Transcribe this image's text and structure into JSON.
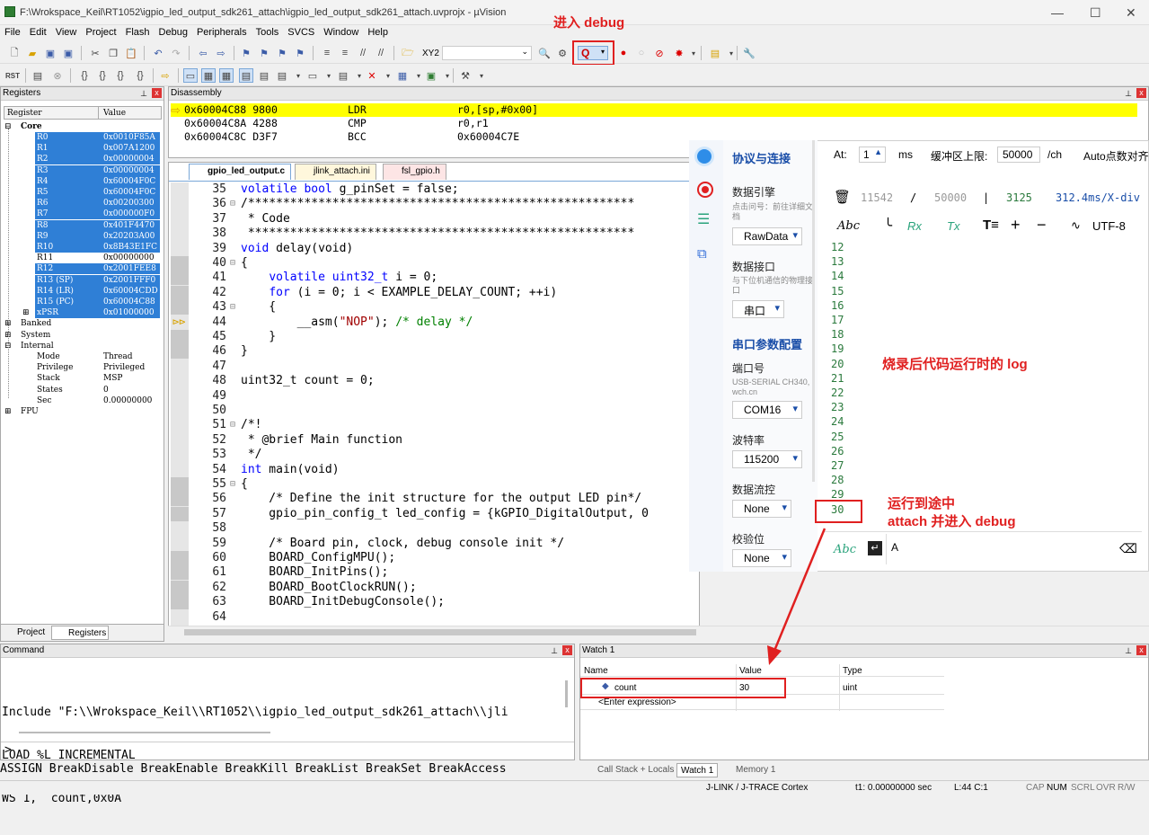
{
  "window": {
    "title": "F:\\Wrokspace_Keil\\RT1052\\igpio_led_output_sdk261_attach\\igpio_led_output_sdk261_attach.uvprojx - µVision"
  },
  "menu": [
    "File",
    "Edit",
    "View",
    "Project",
    "Flash",
    "Debug",
    "Peripherals",
    "Tools",
    "SVCS",
    "Window",
    "Help"
  ],
  "toolbar": {
    "target_label": "XY2"
  },
  "annotations": {
    "enter_debug": "进入 debug",
    "log_label": "烧录后代码运行时的 log",
    "attach_line1": "运行到途中",
    "attach_line2": "attach 并进入 debug"
  },
  "registers": {
    "title": "Registers",
    "col_register": "Register",
    "col_value": "Value",
    "core_label": "Core",
    "rows": [
      {
        "name": "R0",
        "value": "0x0010F85A"
      },
      {
        "name": "R1",
        "value": "0x007A1200"
      },
      {
        "name": "R2",
        "value": "0x00000004"
      },
      {
        "name": "R3",
        "value": "0x00000004"
      },
      {
        "name": "R4",
        "value": "0x60004F0C"
      },
      {
        "name": "R5",
        "value": "0x60004F0C"
      },
      {
        "name": "R6",
        "value": "0x00200300"
      },
      {
        "name": "R7",
        "value": "0x000000F0"
      },
      {
        "name": "R8",
        "value": "0x401F4470"
      },
      {
        "name": "R9",
        "value": "0x20203A00"
      },
      {
        "name": "R10",
        "value": "0x8B43E1FC"
      },
      {
        "name": "R11",
        "value": "0x00000000"
      },
      {
        "name": "R12",
        "value": "0x2001FEE8"
      },
      {
        "name": "R13 (SP)",
        "value": "0x2001FFF0"
      },
      {
        "name": "R14 (LR)",
        "value": "0x60004CDD"
      },
      {
        "name": "R15 (PC)",
        "value": "0x60004C88"
      },
      {
        "name": "xPSR",
        "value": "0x01000000"
      }
    ],
    "groups": [
      "Banked",
      "System",
      "Internal"
    ],
    "internal": [
      {
        "name": "Mode",
        "value": "Thread"
      },
      {
        "name": "Privilege",
        "value": "Privileged"
      },
      {
        "name": "Stack",
        "value": "MSP"
      },
      {
        "name": "States",
        "value": "0"
      },
      {
        "name": "Sec",
        "value": "0.00000000"
      }
    ],
    "fpu": "FPU",
    "tab_project": "Project",
    "tab_registers": "Registers"
  },
  "disassembly": {
    "title": "Disassembly",
    "lines": [
      {
        "addr": "0x60004C88",
        "code": "9800",
        "mn": "LDR",
        "op": "r0,[sp,#0x00]"
      },
      {
        "addr": "0x60004C8A",
        "code": "4288",
        "mn": "CMP",
        "op": "r0,r1"
      },
      {
        "addr": "0x60004C8C",
        "code": "D3F7",
        "mn": "BCC",
        "op": "0x60004C7E"
      }
    ]
  },
  "editor": {
    "tabs": [
      "gpio_led_output.c",
      "jlink_attach.ini",
      "fsl_gpio.h"
    ],
    "lines": [
      {
        "n": "35",
        "f": "",
        "t": "volatile bool g_pinSet = false;",
        "k": "kw"
      },
      {
        "n": "36",
        "f": "⊟",
        "t": "/*******************************************************",
        "k": "cm"
      },
      {
        "n": "37",
        "f": "",
        "t": " * Code",
        "k": "cm"
      },
      {
        "n": "38",
        "f": "",
        "t": " *******************************************************",
        "k": "cm"
      },
      {
        "n": "39",
        "f": "",
        "t": "void delay(void)",
        "k": "kw"
      },
      {
        "n": "40",
        "f": "⊟",
        "t": "{",
        "k": ""
      },
      {
        "n": "41",
        "f": "",
        "t": "    volatile uint32_t i = 0;",
        "k": "kw"
      },
      {
        "n": "42",
        "f": "",
        "t": "    for (i = 0; i < EXAMPLE_DELAY_COUNT; ++i)",
        "k": "kw"
      },
      {
        "n": "43",
        "f": "⊟",
        "t": "    {",
        "k": ""
      },
      {
        "n": "44",
        "f": "",
        "t": "        __asm(\"NOP\"); /* delay */",
        "k": "st"
      },
      {
        "n": "45",
        "f": "",
        "t": "    }",
        "k": ""
      },
      {
        "n": "46",
        "f": "",
        "t": "}",
        "k": ""
      },
      {
        "n": "47",
        "f": "",
        "t": "",
        "k": ""
      },
      {
        "n": "48",
        "f": "",
        "t": "uint32_t count = 0;",
        "k": ""
      },
      {
        "n": "49",
        "f": "",
        "t": "",
        "k": ""
      },
      {
        "n": "50",
        "f": "",
        "t": "",
        "k": ""
      },
      {
        "n": "51",
        "f": "⊟",
        "t": "/*!",
        "k": "cm"
      },
      {
        "n": "52",
        "f": "",
        "t": " * @brief Main function",
        "k": "cm"
      },
      {
        "n": "53",
        "f": "",
        "t": " */",
        "k": "cm"
      },
      {
        "n": "54",
        "f": "",
        "t": "int main(void)",
        "k": "kw"
      },
      {
        "n": "55",
        "f": "⊟",
        "t": "{",
        "k": ""
      },
      {
        "n": "56",
        "f": "",
        "t": "    /* Define the init structure for the output LED pin*/",
        "k": "cm"
      },
      {
        "n": "57",
        "f": "",
        "t": "    gpio_pin_config_t led_config = {kGPIO_DigitalOutput, 0",
        "k": ""
      },
      {
        "n": "58",
        "f": "",
        "t": "",
        "k": ""
      },
      {
        "n": "59",
        "f": "",
        "t": "    /* Board pin, clock, debug console init */",
        "k": "cm"
      },
      {
        "n": "60",
        "f": "",
        "t": "    BOARD_ConfigMPU();",
        "k": ""
      },
      {
        "n": "61",
        "f": "",
        "t": "    BOARD_InitPins();",
        "k": ""
      },
      {
        "n": "62",
        "f": "",
        "t": "    BOARD_BootClockRUN();",
        "k": ""
      },
      {
        "n": "63",
        "f": "",
        "t": "    BOARD_InitDebugConsole();",
        "k": ""
      },
      {
        "n": "64",
        "f": "",
        "t": "",
        "k": ""
      }
    ]
  },
  "serial": {
    "cfg": {
      "h1": "协议与连接",
      "engine_label": "数据引擎",
      "engine_hint": "点击问号：前往详细文档",
      "engine_value": "RawData",
      "iface_label": "数据接口",
      "iface_hint": "与下位机通信的物理接口",
      "iface_value": "串口",
      "h2": "串口参数配置",
      "port_label": "端口号",
      "port_hint": "USB-SERIAL CH340, wch.cn",
      "port_value": "COM16",
      "baud_label": "波特率",
      "baud_value": "115200",
      "flow_label": "数据流控",
      "flow_value": "None",
      "parity_label": "校验位",
      "parity_value": "None"
    },
    "top": {
      "at_label": "At:",
      "at_value": "1",
      "ms": "ms",
      "buf_label": "缓冲区上限:",
      "buf_value": "50000",
      "ch": "/ch",
      "auto": "Auto点数对齐"
    },
    "stats": {
      "a": "11542",
      "sep": "/",
      "b": "50000",
      "bar": "|",
      "c": "3125",
      "d": "312.4ms/X-div"
    },
    "tools": {
      "abc": "Abc",
      "rx": "Rx",
      "tx": "Tx",
      "plus": "+",
      "minus": "−",
      "enc": "UTF-8"
    },
    "log": [
      "12",
      "13",
      "14",
      "15",
      "16",
      "17",
      "18",
      "19",
      "20",
      "21",
      "22",
      "23",
      "24",
      "25",
      "26",
      "27",
      "28",
      "29",
      "30"
    ],
    "input_value": "A",
    "input_abc": "Abc"
  },
  "command": {
    "title": "Command",
    "lines": [
      "Include \"F:\\\\Wrokspace_Keil\\\\RT1052\\\\igpio_led_output_sdk261_attach\\\\jli",
      "LOAD %L INCREMENTAL",
      "WS 1, `count,0x0A"
    ],
    "prompt": ">",
    "hints": "ASSIGN BreakDisable BreakEnable BreakKill BreakList BreakSet BreakAccess"
  },
  "watch": {
    "title": "Watch 1",
    "col_name": "Name",
    "col_value": "Value",
    "col_type": "Type",
    "row": {
      "name": "count",
      "value": "30",
      "type": "uint"
    },
    "enter": "<Enter expression>",
    "tabs": [
      "Call Stack + Locals",
      "Watch 1",
      "Memory 1"
    ]
  },
  "status": {
    "debugger": "J-LINK / J-TRACE Cortex",
    "time": "t1: 0.00000000 sec",
    "pos": "L:44 C:1",
    "caps": "CAP",
    "num": "NUM",
    "scrl": "SCRL",
    "ovr": "OVR",
    "rw": "R/W"
  }
}
